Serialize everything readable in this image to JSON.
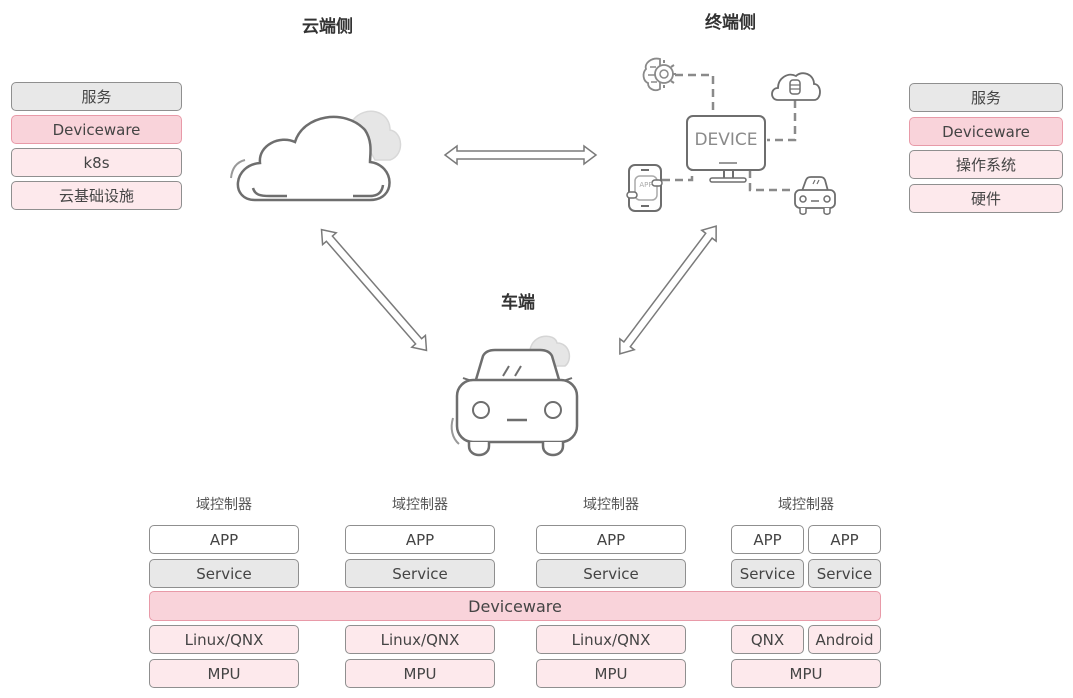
{
  "titles": {
    "cloud": "云端侧",
    "terminal": "终端侧",
    "vehicle": "车端"
  },
  "cloud_stack": [
    {
      "label": "服务",
      "style": "gray"
    },
    {
      "label": "Deviceware",
      "style": "pink"
    },
    {
      "label": "k8s",
      "style": "lightpink"
    },
    {
      "label": "云基础设施",
      "style": "lightpink"
    }
  ],
  "terminal_stack": [
    {
      "label": "服务",
      "style": "gray"
    },
    {
      "label": "Deviceware",
      "style": "pink"
    },
    {
      "label": "操作系统",
      "style": "lightpink"
    },
    {
      "label": "硬件",
      "style": "lightpink"
    }
  ],
  "device_illustration": {
    "screen_text": "DEVICE",
    "phone_text": "APP",
    "icons": [
      "brain-gear-icon",
      "cloud-database-icon",
      "phone-app-icon",
      "car-icon"
    ]
  },
  "vehicle": {
    "shared_layer": "Deviceware",
    "controllers": [
      {
        "title": "域控制器",
        "app": [
          "APP"
        ],
        "service": [
          "Service"
        ],
        "os": [
          "Linux/QNX"
        ],
        "hw": "MPU"
      },
      {
        "title": "域控制器",
        "app": [
          "APP"
        ],
        "service": [
          "Service"
        ],
        "os": [
          "Linux/QNX"
        ],
        "hw": "MPU"
      },
      {
        "title": "域控制器",
        "app": [
          "APP"
        ],
        "service": [
          "Service"
        ],
        "os": [
          "Linux/QNX"
        ],
        "hw": "MPU"
      },
      {
        "title": "域控制器",
        "app": [
          "APP",
          "APP"
        ],
        "service": [
          "Service",
          "Service"
        ],
        "os": [
          "QNX",
          "Android"
        ],
        "hw": "MPU"
      }
    ]
  }
}
